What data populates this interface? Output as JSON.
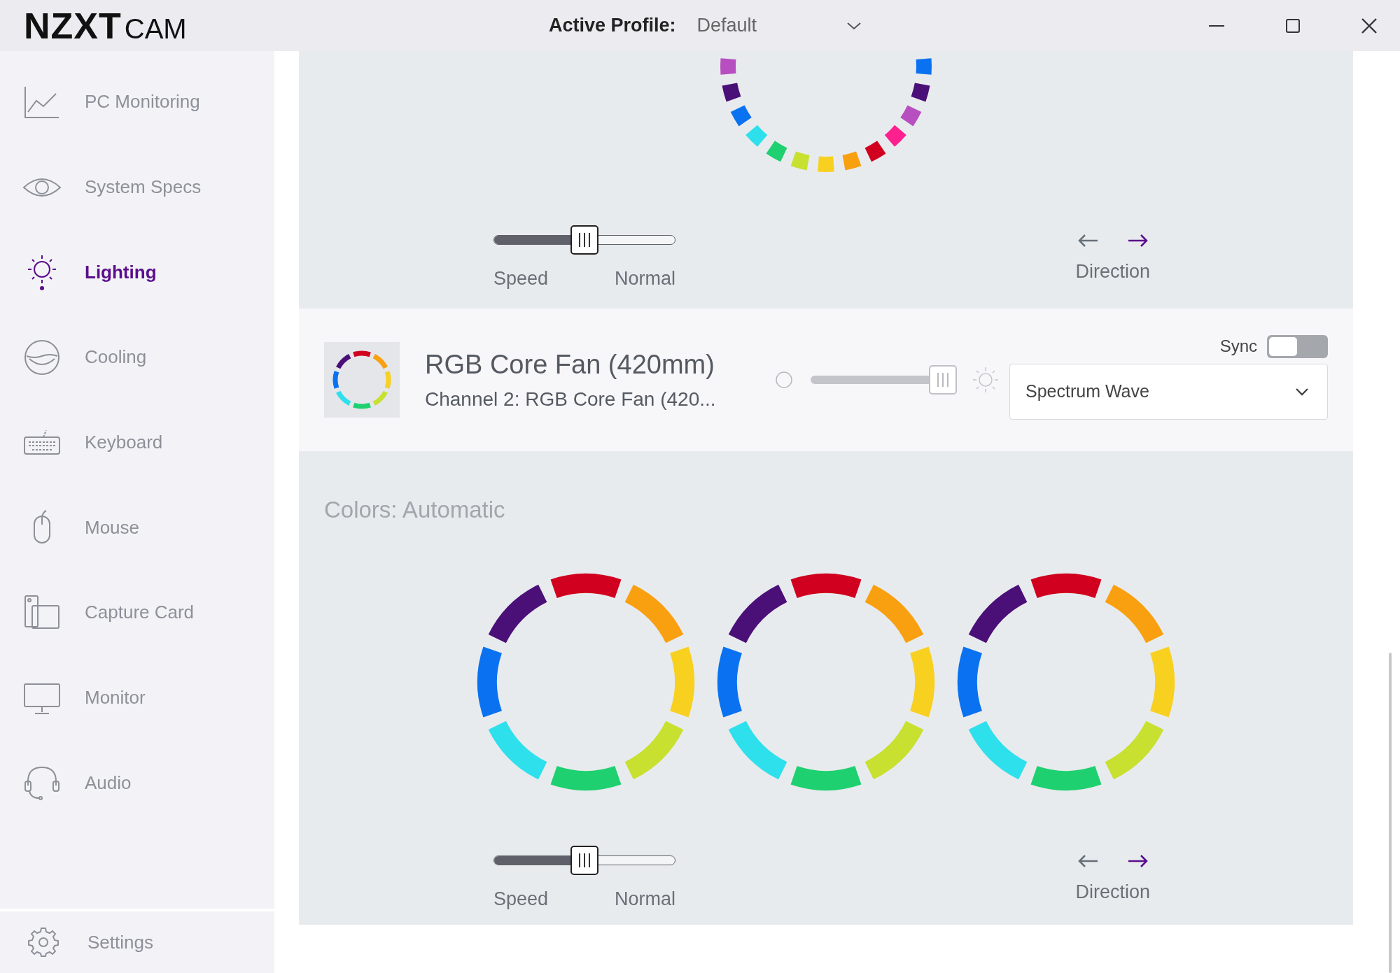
{
  "app": {
    "brand": "NZXT",
    "product": "CAM"
  },
  "profile": {
    "label": "Active Profile:",
    "value": "Default"
  },
  "sidebar": {
    "items": [
      {
        "label": "PC Monitoring",
        "kind": "monitoring",
        "selected": false
      },
      {
        "label": "System Specs",
        "kind": "specs",
        "selected": false
      },
      {
        "label": "Lighting",
        "kind": "lighting",
        "selected": true
      },
      {
        "label": "Cooling",
        "kind": "cooling",
        "selected": false
      },
      {
        "label": "Keyboard",
        "kind": "keyboard",
        "selected": false
      },
      {
        "label": "Mouse",
        "kind": "mouse",
        "selected": false
      },
      {
        "label": "Capture Card",
        "kind": "capture",
        "selected": false
      },
      {
        "label": "Monitor",
        "kind": "monitor",
        "selected": false
      },
      {
        "label": "Audio",
        "kind": "audio",
        "selected": false
      }
    ],
    "settings": {
      "label": "Settings"
    }
  },
  "top_effect": {
    "leds": [
      {
        "color": "#b84fc0"
      },
      {
        "color": "#4b0f78"
      },
      {
        "color": "#0a72f0"
      },
      {
        "color": "#2ee0ec"
      },
      {
        "color": "#1fd070"
      },
      {
        "color": "#c8e030"
      },
      {
        "color": "#f8d020"
      },
      {
        "color": "#f8a010"
      },
      {
        "color": "#d0001e"
      },
      {
        "color": "#ff2090"
      },
      {
        "color": "#b84fc0"
      },
      {
        "color": "#4b0f78"
      },
      {
        "color": "#0a72f0"
      }
    ],
    "speed": {
      "label": "Speed",
      "value": "Normal",
      "level": 0.5
    },
    "direction": {
      "label": "Direction",
      "options": [
        {
          "kind": "left",
          "selected": false
        },
        {
          "kind": "right",
          "selected": true
        }
      ]
    }
  },
  "device": {
    "name": "RGB Core Fan (420mm)",
    "channel": "Channel 2: RGB Core Fan (420...",
    "brightness": {
      "level": 0.92
    },
    "sync": {
      "label": "Sync",
      "on": false
    },
    "mode": {
      "value": "Spectrum Wave"
    }
  },
  "bottom_effect": {
    "colors_label": "Colors: Automatic",
    "fans": [
      {
        "segments": [
          {
            "color": "#d0001e"
          },
          {
            "color": "#f8a010"
          },
          {
            "color": "#f8d020"
          },
          {
            "color": "#c8e030"
          },
          {
            "color": "#1fd070"
          },
          {
            "color": "#2ee0ec"
          },
          {
            "color": "#0a72f0"
          },
          {
            "color": "#4b0f78"
          }
        ]
      },
      {
        "segments": [
          {
            "color": "#d0001e"
          },
          {
            "color": "#f8a010"
          },
          {
            "color": "#f8d020"
          },
          {
            "color": "#c8e030"
          },
          {
            "color": "#1fd070"
          },
          {
            "color": "#2ee0ec"
          },
          {
            "color": "#0a72f0"
          },
          {
            "color": "#4b0f78"
          }
        ]
      },
      {
        "segments": [
          {
            "color": "#d0001e"
          },
          {
            "color": "#f8a010"
          },
          {
            "color": "#f8d020"
          },
          {
            "color": "#c8e030"
          },
          {
            "color": "#1fd070"
          },
          {
            "color": "#2ee0ec"
          },
          {
            "color": "#0a72f0"
          },
          {
            "color": "#4b0f78"
          }
        ]
      }
    ],
    "speed": {
      "label": "Speed",
      "value": "Normal",
      "level": 0.5
    },
    "direction": {
      "label": "Direction",
      "options": [
        {
          "kind": "left",
          "selected": false
        },
        {
          "kind": "right",
          "selected": true
        }
      ]
    }
  }
}
